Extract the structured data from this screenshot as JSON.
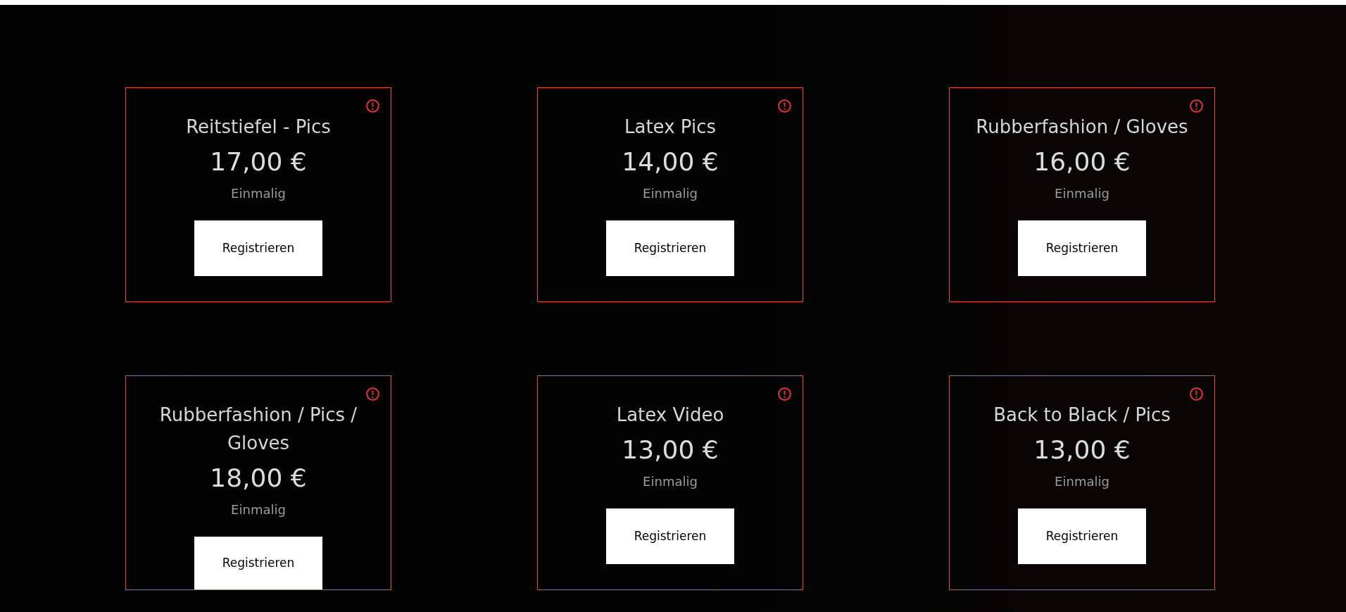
{
  "plans": [
    {
      "title": "Reitstiefel - Pics",
      "price": "17,00 €",
      "billing": "Einmalig",
      "button": "Registrieren"
    },
    {
      "title": "Latex Pics",
      "price": "14,00 €",
      "billing": "Einmalig",
      "button": "Registrieren"
    },
    {
      "title": "Rubberfashion / Gloves",
      "price": "16,00 €",
      "billing": "Einmalig",
      "button": "Registrieren"
    },
    {
      "title": "Rubberfashion / Pics / Gloves",
      "price": "18,00 €",
      "billing": "Einmalig",
      "button": "Registrieren"
    },
    {
      "title": "Latex Video",
      "price": "13,00 €",
      "billing": "Einmalig",
      "button": "Registrieren"
    },
    {
      "title": "Back to Black / Pics",
      "price": "13,00 €",
      "billing": "Einmalig",
      "button": "Registrieren"
    }
  ]
}
